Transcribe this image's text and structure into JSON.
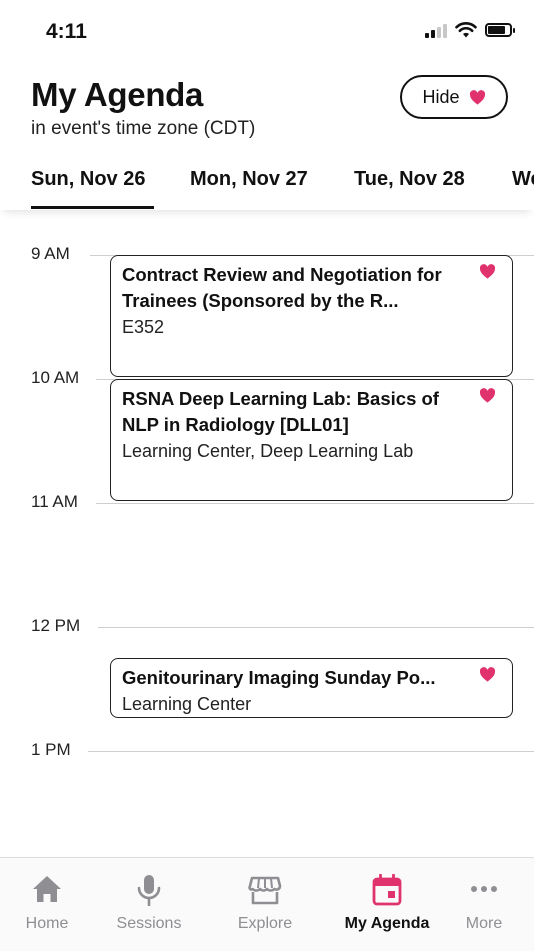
{
  "status_bar": {
    "time": "4:11",
    "battery_level": 0.8
  },
  "header": {
    "title": "My Agenda",
    "timezone_caption": "in event's time zone (CDT)",
    "hide_label": "Hide"
  },
  "date_tabs": [
    {
      "label": "Sun, Nov 26",
      "selected": true
    },
    {
      "label": "Mon, Nov 27",
      "selected": false
    },
    {
      "label": "Tue, Nov 28",
      "selected": false
    },
    {
      "label": "We",
      "selected": false
    }
  ],
  "timeline": {
    "hours": [
      "9 AM",
      "10 AM",
      "11 AM",
      "12 PM",
      "1 PM"
    ]
  },
  "sessions": [
    {
      "title": "Contract Review and Negotiation for Trainees (Sponsored by the R...",
      "location": "E352",
      "favorited": true
    },
    {
      "title": "RSNA Deep Learning Lab: Basics of NLP in Radiology [DLL01]",
      "location": "Learning Center, Deep Learning Lab",
      "favorited": true
    },
    {
      "title": "Genitourinary Imaging Sunday Po...",
      "location": "Learning Center",
      "favorited": true
    }
  ],
  "bottom_nav": [
    {
      "label": "Home",
      "icon": "home-icon",
      "active": false
    },
    {
      "label": "Sessions",
      "icon": "microphone-icon",
      "active": false
    },
    {
      "label": "Explore",
      "icon": "storefront-icon",
      "active": false
    },
    {
      "label": "My Agenda",
      "icon": "calendar-icon",
      "active": true
    },
    {
      "label": "More",
      "icon": "more-dots-icon",
      "active": false
    }
  ],
  "colors": {
    "accent": "#E0336D",
    "text": "#111111",
    "inactive": "#8E8E93",
    "divider": "#CFCFCF"
  }
}
